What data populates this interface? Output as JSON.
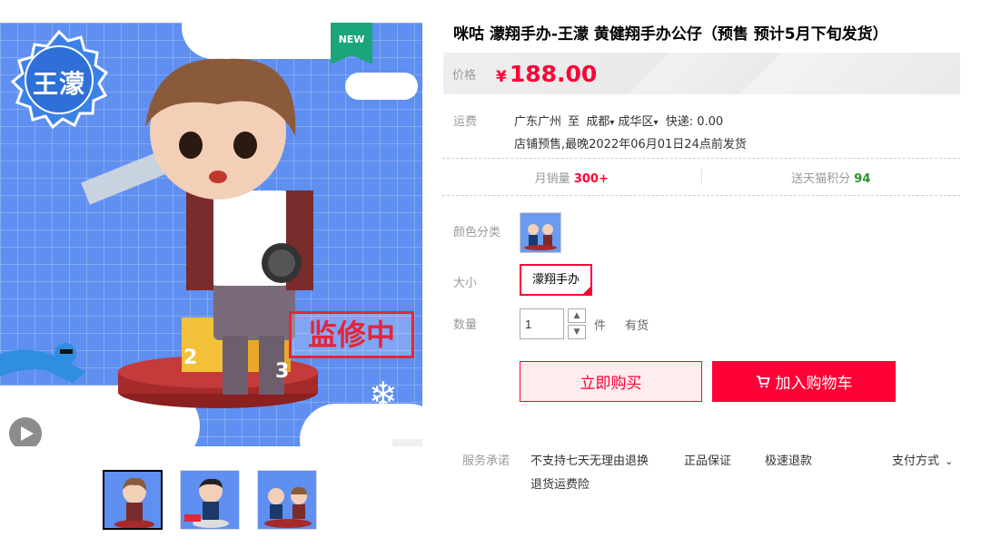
{
  "product": {
    "title": "咪咕 濛翔手办-王濛 黄健翔手办公仔（预售 预计5月下旬发货）",
    "badge_text": "王濛",
    "new_tag": "NEW",
    "stamp_text": "监修中",
    "podium_numbers": [
      "2",
      "3"
    ]
  },
  "price": {
    "label": "价格",
    "currency": "¥",
    "value": "188.00"
  },
  "shipping": {
    "label": "运费",
    "from": "广东广州",
    "to_word": "至",
    "city": "成都",
    "district": "成华区",
    "express": "快递: 0.00",
    "presale_note": "店铺预售,最晚2022年06月01日24点前发货"
  },
  "stats": {
    "monthly_sales_label": "月销量",
    "monthly_sales_value": "300+",
    "points_label": "送天猫积分",
    "points_value": "94"
  },
  "options": {
    "color_label": "颜色分类",
    "size_label": "大小",
    "size_value": "濛翔手办",
    "qty_label": "数量",
    "qty_value": "1",
    "qty_unit": "件",
    "stock_status": "有货"
  },
  "buttons": {
    "buy_now": "立即购买",
    "add_cart": "加入购物车"
  },
  "service": {
    "label": "服务承诺",
    "items": [
      "不支持七天无理由退换",
      "正品保证",
      "极速退款",
      "退货运费险"
    ],
    "payment": "支付方式"
  },
  "colors": {
    "accent": "#ff0036",
    "image_bg": "#5f8ff0",
    "points_green": "#229922",
    "new_tag": "#1aa67a"
  }
}
